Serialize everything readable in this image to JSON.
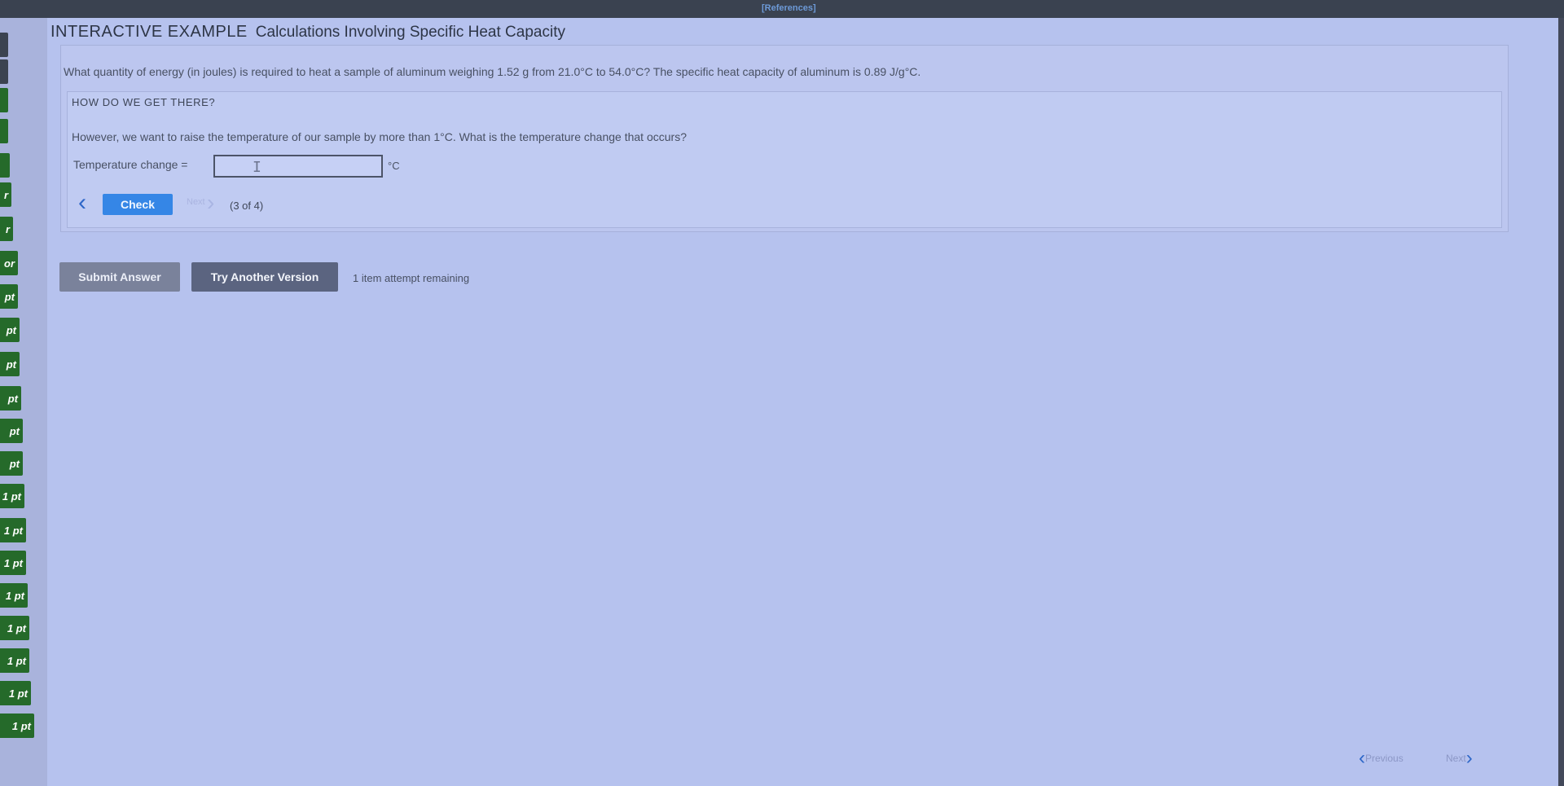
{
  "top_bar": {
    "references_label": "[References]"
  },
  "left_nav": {
    "items": [
      {
        "label": ""
      },
      {
        "label": ""
      },
      {
        "label": ""
      },
      {
        "label": ""
      },
      {
        "label": ""
      },
      {
        "label": "r"
      },
      {
        "label": "r"
      },
      {
        "label": "or"
      },
      {
        "label": "pt"
      },
      {
        "label": "pt"
      },
      {
        "label": "pt"
      },
      {
        "label": "pt"
      },
      {
        "label": "pt"
      },
      {
        "label": "pt"
      },
      {
        "label": "1 pt"
      },
      {
        "label": "1 pt"
      },
      {
        "label": "1 pt"
      },
      {
        "label": "1 pt"
      },
      {
        "label": "1 pt"
      },
      {
        "label": "1 pt"
      },
      {
        "label": "1 pt"
      },
      {
        "label": "1 pt"
      }
    ]
  },
  "heading": {
    "tag": "INTERACTIVE EXAMPLE",
    "title": "Calculations Involving Specific Heat Capacity"
  },
  "question": {
    "text": "What quantity of energy (in joules) is required to heat a sample of aluminum weighing 1.52 g from 21.0°C to 54.0°C? The specific heat capacity of aluminum is 0.89 J/g°C."
  },
  "howto": {
    "title": "HOW DO WE GET THERE?",
    "body": "However, we want to raise the temperature of our sample by more than 1°C. What is the temperature change that occurs?",
    "field_label": "Temperature change =",
    "field_value": "",
    "unit": "°C",
    "check_label": "Check",
    "next_label": "Next",
    "step_label": "(3 of 4)"
  },
  "actions": {
    "submit_label": "Submit Answer",
    "try_label": "Try Another Version",
    "attempts_text": "1 item attempt remaining"
  },
  "pager": {
    "previous_label": "Previous",
    "next_label": "Next"
  }
}
